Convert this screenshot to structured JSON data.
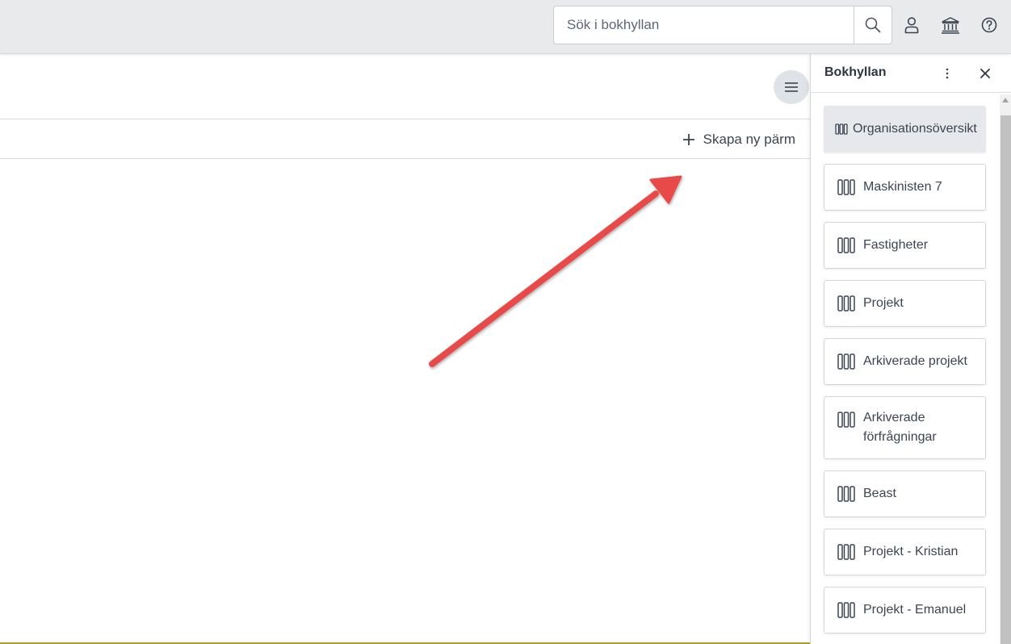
{
  "topbar": {
    "search_placeholder": "Sök i bokhyllan",
    "icons": [
      "search-icon",
      "user-icon",
      "bank-icon",
      "help-icon"
    ]
  },
  "main": {
    "create_binder_label": "Skapa ny pärm"
  },
  "panel": {
    "title": "Bokhyllan",
    "items": [
      {
        "label": "Organisationsöversikt"
      },
      {
        "label": "Maskinisten 7"
      },
      {
        "label": "Fastigheter"
      },
      {
        "label": "Projekt"
      },
      {
        "label": "Arkiverade projekt"
      },
      {
        "label": "Arkiverade förfrågningar"
      },
      {
        "label": "Beast"
      },
      {
        "label": "Projekt - Kristian"
      },
      {
        "label": "Projekt - Emanuel"
      }
    ]
  },
  "colors": {
    "annotation_arrow": "#e84a4a",
    "text": "#3b4552",
    "topbar_bg": "#e9eaec"
  }
}
